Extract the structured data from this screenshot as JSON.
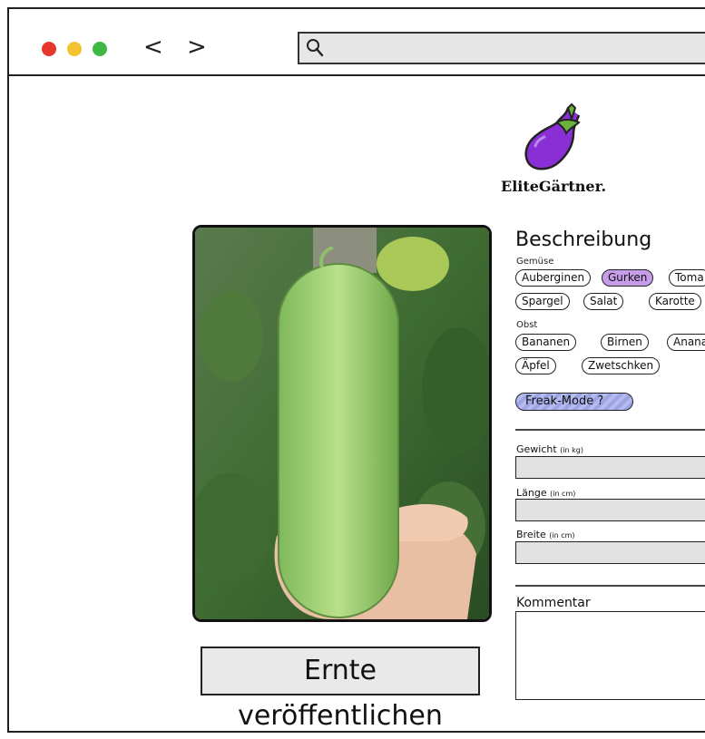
{
  "browser": {
    "back_label": "<",
    "forward_label": ">",
    "address_value": "",
    "icons": [
      "search-icon"
    ]
  },
  "brand": {
    "name": "EliteGärtner.",
    "logo_icon": "eggplant-icon",
    "accent_color": "#8a2fd6"
  },
  "form": {
    "title": "Beschreibung",
    "groups": [
      {
        "label": "Gemüse",
        "tags": [
          {
            "label": "Auberginen",
            "active": false
          },
          {
            "label": "Gurken",
            "active": true
          },
          {
            "label": "Toma",
            "active": false
          },
          {
            "label": "Spargel",
            "active": false
          },
          {
            "label": "Salat",
            "active": false
          },
          {
            "label": "Karotte",
            "active": false
          }
        ]
      },
      {
        "label": "Obst",
        "tags": [
          {
            "label": "Bananen",
            "active": false
          },
          {
            "label": "Birnen",
            "active": false
          },
          {
            "label": "Anana",
            "active": false
          },
          {
            "label": "Äpfel",
            "active": false
          },
          {
            "label": "Zwetschken",
            "active": false
          }
        ]
      }
    ],
    "freak_mode_label": "Freak-Mode ?",
    "fields": [
      {
        "label": "Gewicht",
        "unit": "(in kg)",
        "value": ""
      },
      {
        "label": "Länge",
        "unit": "(in cm)",
        "value": ""
      },
      {
        "label": "Breite",
        "unit": "(in cm)",
        "value": ""
      }
    ],
    "comment_label": "Kommentar",
    "comment_value": ""
  },
  "photo": {
    "subject": "cucumber-photo"
  },
  "actions": {
    "publish_label": "Ernte veröffentlichen"
  }
}
